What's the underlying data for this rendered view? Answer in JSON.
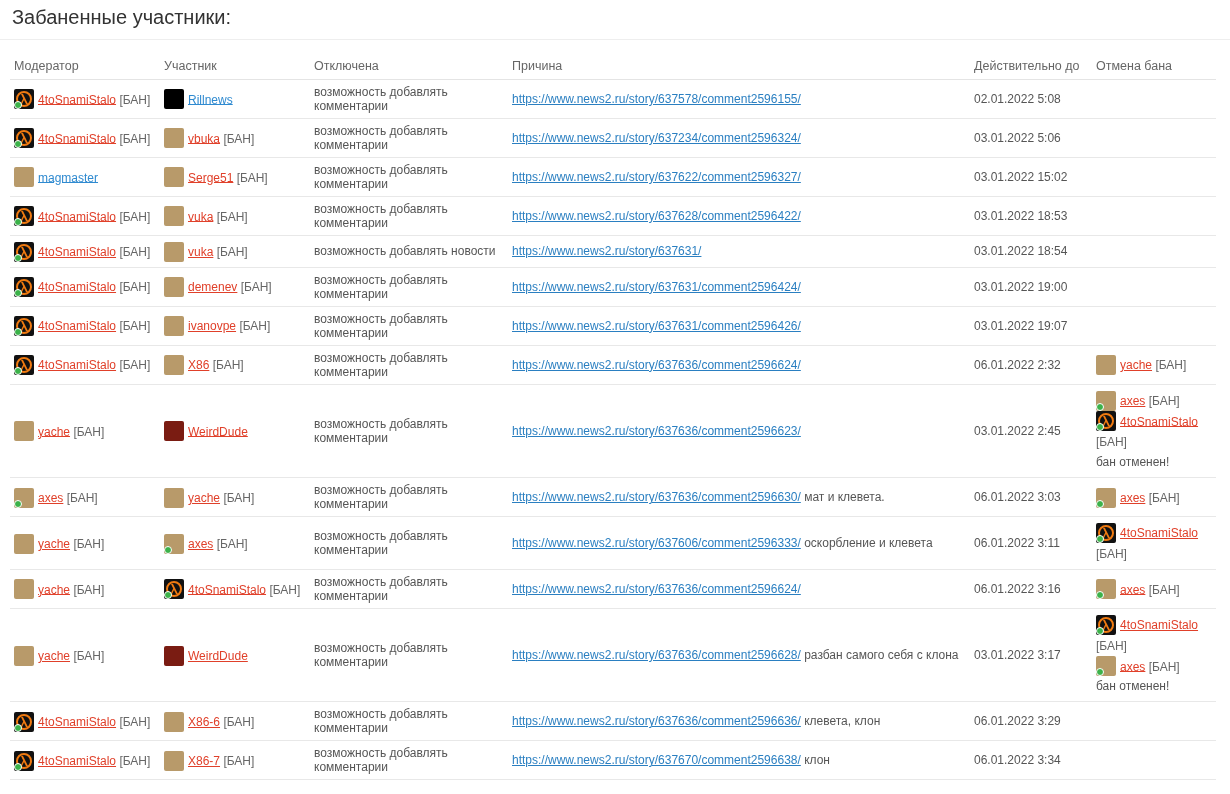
{
  "title": "Забаненные участники:",
  "columns": [
    "Модератор",
    "Участник",
    "Отключена",
    "Причина",
    "Действительно до",
    "Отмена бана"
  ],
  "rows": [
    {
      "moderator": {
        "name": "4toSnamiStalo",
        "tag": "[БАН]",
        "kind": "lambda",
        "online": true,
        "color": "#e0402a"
      },
      "member": {
        "name": "Rillnews",
        "kind": "rn",
        "online": false,
        "color": "#2f8ad0"
      },
      "disabled": "возможность добавлять комментарии",
      "link": "https://www.news2.ru/story/637578/comment2596155/",
      "until": "02.01.2022 5:08",
      "unban": []
    },
    {
      "moderator": {
        "name": "4toSnamiStalo",
        "tag": "[БАН]",
        "kind": "lambda",
        "online": true,
        "color": "#e0402a"
      },
      "member": {
        "name": "vbuka",
        "tag": "[БАН]",
        "kind": "photo",
        "online": false,
        "color": "#e0402a"
      },
      "disabled": "возможность добавлять комментарии",
      "link": "https://www.news2.ru/story/637234/comment2596324/",
      "until": "03.01.2022 5:06",
      "unban": []
    },
    {
      "moderator": {
        "name": "magmaster",
        "kind": "photo",
        "online": false,
        "color": "#2f8ad0"
      },
      "member": {
        "name": "Serge51",
        "tag": "[БАН]",
        "kind": "photo",
        "online": false,
        "color": "#e0402a"
      },
      "disabled": "возможность добавлять комментарии",
      "link": "https://www.news2.ru/story/637622/comment2596327/",
      "until": "03.01.2022 15:02",
      "unban": []
    },
    {
      "moderator": {
        "name": "4toSnamiStalo",
        "tag": "[БАН]",
        "kind": "lambda",
        "online": true,
        "color": "#e0402a"
      },
      "member": {
        "name": "vuka",
        "tag": "[БАН]",
        "kind": "photo",
        "online": false,
        "color": "#e0402a"
      },
      "disabled": "возможность добавлять комментарии",
      "link": "https://www.news2.ru/story/637628/comment2596422/",
      "until": "03.01.2022 18:53",
      "unban": []
    },
    {
      "moderator": {
        "name": "4toSnamiStalo",
        "tag": "[БАН]",
        "kind": "lambda",
        "online": true,
        "color": "#e0402a"
      },
      "member": {
        "name": "vuka",
        "tag": "[БАН]",
        "kind": "photo",
        "online": false,
        "color": "#e0402a"
      },
      "disabled": "возможность добавлять новости",
      "link": "https://www.news2.ru/story/637631/",
      "until": "03.01.2022 18:54",
      "unban": []
    },
    {
      "moderator": {
        "name": "4toSnamiStalo",
        "tag": "[БАН]",
        "kind": "lambda",
        "online": true,
        "color": "#e0402a"
      },
      "member": {
        "name": "demenev",
        "tag": "[БАН]",
        "kind": "photo",
        "online": false,
        "color": "#e0402a"
      },
      "disabled": "возможность добавлять комментарии",
      "link": "https://www.news2.ru/story/637631/comment2596424/",
      "until": "03.01.2022 19:00",
      "unban": []
    },
    {
      "moderator": {
        "name": "4toSnamiStalo",
        "tag": "[БАН]",
        "kind": "lambda",
        "online": true,
        "color": "#e0402a"
      },
      "member": {
        "name": "ivanovpe",
        "tag": "[БАН]",
        "kind": "photo",
        "online": false,
        "color": "#e0402a"
      },
      "disabled": "возможность добавлять комментарии",
      "link": "https://www.news2.ru/story/637631/comment2596426/",
      "until": "03.01.2022 19:07",
      "unban": []
    },
    {
      "moderator": {
        "name": "4toSnamiStalo",
        "tag": "[БАН]",
        "kind": "lambda",
        "online": true,
        "color": "#e0402a"
      },
      "member": {
        "name": "X86",
        "tag": "[БАН]",
        "kind": "photo",
        "online": false,
        "color": "#e0402a"
      },
      "disabled": "возможность добавлять комментарии",
      "link": "https://www.news2.ru/story/637636/comment2596624/",
      "until": "06.01.2022 2:32",
      "unban": [
        {
          "name": "yache",
          "tag": "[БАН]",
          "kind": "photo",
          "online": false,
          "color": "#e0402a"
        }
      ]
    },
    {
      "moderator": {
        "name": "yache",
        "tag": "[БАН]",
        "kind": "photo",
        "online": false,
        "color": "#e0402a"
      },
      "member": {
        "name": "WeirdDude",
        "kind": "cartoon",
        "online": false,
        "color": "#e0402a"
      },
      "disabled": "возможность добавлять комментарии",
      "link": "https://www.news2.ru/story/637636/comment2596623/",
      "until": "03.01.2022 2:45",
      "unban": [
        {
          "name": "axes",
          "tag": "[БАН]",
          "kind": "photo",
          "online": true,
          "color": "#e0402a"
        },
        {
          "name": "4toSnamiStalo",
          "tag": "[БАН]",
          "kind": "lambda",
          "online": true,
          "color": "#e0402a"
        }
      ],
      "unban_note": "бан отменен!"
    },
    {
      "moderator": {
        "name": "axes",
        "tag": "[БАН]",
        "kind": "photo",
        "online": true,
        "color": "#e0402a"
      },
      "member": {
        "name": "yache",
        "tag": "[БАН]",
        "kind": "photo",
        "online": false,
        "color": "#e0402a"
      },
      "disabled": "возможность добавлять комментарии",
      "link": "https://www.news2.ru/story/637636/comment2596630/",
      "comment": "мат и клевета.",
      "until": "06.01.2022 3:03",
      "unban": [
        {
          "name": "axes",
          "tag": "[БАН]",
          "kind": "photo",
          "online": true,
          "color": "#e0402a"
        }
      ]
    },
    {
      "moderator": {
        "name": "yache",
        "tag": "[БАН]",
        "kind": "photo",
        "online": false,
        "color": "#e0402a"
      },
      "member": {
        "name": "axes",
        "tag": "[БАН]",
        "kind": "photo",
        "online": true,
        "color": "#e0402a"
      },
      "disabled": "возможность добавлять комментарии",
      "link": "https://www.news2.ru/story/637606/comment2596333/",
      "comment": "оскорбление и клевета",
      "until": "06.01.2022 3:11",
      "unban": [
        {
          "name": "4toSnamiStalo",
          "tag": "[БАН]",
          "kind": "lambda",
          "online": true,
          "color": "#e0402a"
        }
      ]
    },
    {
      "moderator": {
        "name": "yache",
        "tag": "[БАН]",
        "kind": "photo",
        "online": false,
        "color": "#e0402a"
      },
      "member": {
        "name": "4toSnamiStalo",
        "tag": "[БАН]",
        "kind": "lambda",
        "online": true,
        "color": "#e0402a"
      },
      "disabled": "возможность добавлять комментарии",
      "link": "https://www.news2.ru/story/637636/comment2596624/",
      "until": "06.01.2022 3:16",
      "unban": [
        {
          "name": "axes",
          "tag": "[БАН]",
          "kind": "photo",
          "online": true,
          "color": "#e0402a"
        }
      ]
    },
    {
      "moderator": {
        "name": "yache",
        "tag": "[БАН]",
        "kind": "photo",
        "online": false,
        "color": "#e0402a"
      },
      "member": {
        "name": "WeirdDude",
        "kind": "cartoon",
        "online": false,
        "color": "#e0402a"
      },
      "disabled": "возможность добавлять комментарии",
      "link": "https://www.news2.ru/story/637636/comment2596628/",
      "comment": "разбан самого себя с клона",
      "until": "03.01.2022 3:17",
      "unban": [
        {
          "name": "4toSnamiStalo",
          "tag": "[БАН]",
          "kind": "lambda",
          "online": true,
          "color": "#e0402a"
        },
        {
          "name": "axes",
          "tag": "[БАН]",
          "kind": "photo",
          "online": true,
          "color": "#e0402a"
        }
      ],
      "unban_note": "бан отменен!"
    },
    {
      "moderator": {
        "name": "4toSnamiStalo",
        "tag": "[БАН]",
        "kind": "lambda",
        "online": true,
        "color": "#e0402a"
      },
      "member": {
        "name": "X86-6",
        "tag": "[БАН]",
        "kind": "photo",
        "online": false,
        "color": "#e0402a"
      },
      "disabled": "возможность добавлять комментарии",
      "link": "https://www.news2.ru/story/637636/comment2596636/",
      "comment": "клевета, клон",
      "until": "06.01.2022 3:29",
      "unban": []
    },
    {
      "moderator": {
        "name": "4toSnamiStalo",
        "tag": "[БАН]",
        "kind": "lambda",
        "online": true,
        "color": "#e0402a"
      },
      "member": {
        "name": "X86-7",
        "tag": "[БАН]",
        "kind": "photo",
        "online": false,
        "color": "#e0402a"
      },
      "disabled": "возможность добавлять комментарии",
      "link": "https://www.news2.ru/story/637670/comment2596638/",
      "comment": "клон",
      "until": "06.01.2022 3:34",
      "unban": []
    }
  ]
}
